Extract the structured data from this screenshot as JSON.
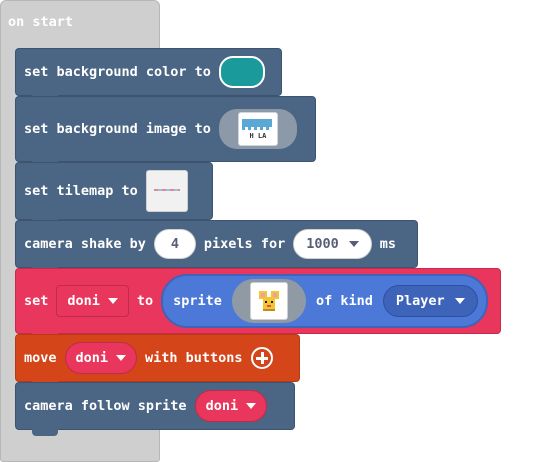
{
  "on_start": {
    "label": "on start"
  },
  "blocks": {
    "bg_color": {
      "label": "set background color to",
      "color": "#1a9a9a"
    },
    "bg_image": {
      "label": "set background image to",
      "image_text": "H LA"
    },
    "tilemap": {
      "label": "set tilemap to"
    },
    "camera_shake": {
      "label1": "camera shake by",
      "amount": "4",
      "label2": "pixels for",
      "duration": "1000",
      "label3": "ms"
    },
    "set_sprite": {
      "label1": "set",
      "variable": "doni",
      "label2": "to",
      "sprite_label": "sprite",
      "label3": "of kind",
      "kind": "Player"
    },
    "move": {
      "label1": "move",
      "variable": "doni",
      "label2": "with buttons"
    },
    "camera_follow": {
      "label": "camera follow sprite",
      "variable": "doni"
    }
  },
  "colors": {
    "scene": "#4b6584",
    "sprites": "#e8365c",
    "sprite_oval": "#4c79d8",
    "controller": "#d4451a",
    "hat": "#cfcfcf"
  }
}
